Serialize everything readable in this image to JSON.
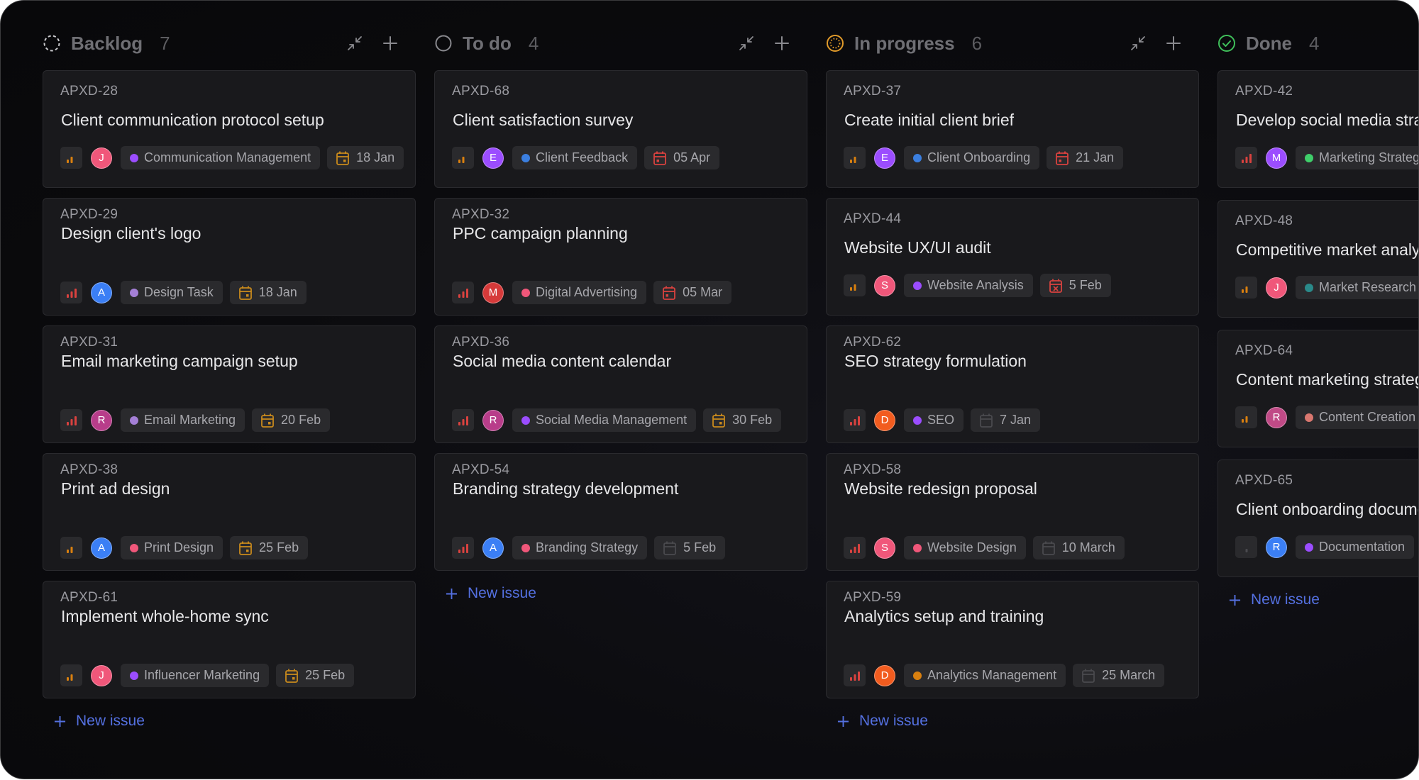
{
  "board": {
    "columns": [
      {
        "id": "backlog",
        "title": "Backlog",
        "count": "7",
        "status_icon": "backlog-dashed-circle-icon",
        "status_color": "#c8c8cc",
        "new_issue_label": "New issue",
        "cards": [
          {
            "id": "APXD-28",
            "title": "Client communication protocol setup",
            "priority": "low",
            "assignee": "J",
            "avatar_color": "#f0577a",
            "label": "Communication Management",
            "label_color": "#9b4dff",
            "date": "18 Jan",
            "date_state": "upcoming"
          },
          {
            "id": "APXD-29",
            "title": "Design client's logo",
            "priority": "high",
            "assignee": "A",
            "avatar_color": "#3b7ff5",
            "label": "Design Task",
            "label_color": "#a47fd6",
            "date": "18 Jan",
            "date_state": "upcoming"
          },
          {
            "id": "APXD-31",
            "title": "Email marketing campaign setup",
            "priority": "high",
            "assignee": "R",
            "avatar_color": "#b83d8a",
            "label": "Email Marketing",
            "label_color": "#a47fd6",
            "date": "20 Feb",
            "date_state": "upcoming"
          },
          {
            "id": "APXD-38",
            "title": "Print ad design",
            "priority": "low",
            "assignee": "A",
            "avatar_color": "#3b7ff5",
            "label": "Print Design",
            "label_color": "#f0577a",
            "date": "25 Feb",
            "date_state": "upcoming"
          },
          {
            "id": "APXD-61",
            "title": "Implement whole-home sync",
            "priority": "low",
            "assignee": "J",
            "avatar_color": "#f0577a",
            "label": "Influencer Marketing",
            "label_color": "#9b4dff",
            "date": "25 Feb",
            "date_state": "upcoming"
          }
        ]
      },
      {
        "id": "todo",
        "title": "To do",
        "count": "4",
        "status_icon": "todo-circle-icon",
        "status_color": "#8a8a8f",
        "new_issue_label": "New issue",
        "cards": [
          {
            "id": "APXD-68",
            "title": "Client satisfaction survey",
            "priority": "low",
            "assignee": "E",
            "avatar_color": "#9b4dff",
            "label": "Client Feedback",
            "label_color": "#3b7fe0",
            "date": "05 Apr",
            "date_state": "due"
          },
          {
            "id": "APXD-32",
            "title": "PPC campaign planning",
            "priority": "high",
            "assignee": "M",
            "avatar_color": "#d63a3a",
            "label": "Digital Advertising",
            "label_color": "#f0577a",
            "date": "05 Mar",
            "date_state": "due"
          },
          {
            "id": "APXD-36",
            "title": "Social media content calendar",
            "priority": "high",
            "assignee": "R",
            "avatar_color": "#b83d8a",
            "label": "Social Media Management",
            "label_color": "#9b4dff",
            "date": "30 Feb",
            "date_state": "upcoming"
          },
          {
            "id": "APXD-54",
            "title": "Branding strategy development",
            "priority": "high",
            "assignee": "A",
            "avatar_color": "#3b7ff5",
            "label": "Branding Strategy",
            "label_color": "#f0577a",
            "date": "5 Feb",
            "date_state": "none"
          }
        ]
      },
      {
        "id": "in-progress",
        "title": "In progress",
        "count": "6",
        "status_icon": "in-progress-circle-icon",
        "status_color": "#e09a2a",
        "new_issue_label": "New issue",
        "cards": [
          {
            "id": "APXD-37",
            "title": "Create initial client brief",
            "priority": "low",
            "assignee": "E",
            "avatar_color": "#9b4dff",
            "label": "Client Onboarding",
            "label_color": "#3b7fe0",
            "date": "21 Jan",
            "date_state": "due"
          },
          {
            "id": "APXD-44",
            "title": "Website UX/UI audit",
            "priority": "low",
            "assignee": "S",
            "avatar_color": "#f0577a",
            "label": "Website Analysis",
            "label_color": "#9b4dff",
            "date": "5 Feb",
            "date_state": "overdue"
          },
          {
            "id": "APXD-62",
            "title": "SEO strategy formulation",
            "priority": "high",
            "assignee": "D",
            "avatar_color": "#f25c1f",
            "label": "SEO",
            "label_color": "#9b4dff",
            "date": "7 Jan",
            "date_state": "none"
          },
          {
            "id": "APXD-58",
            "title": "Website redesign proposal",
            "priority": "high",
            "assignee": "S",
            "avatar_color": "#f0577a",
            "label": "Website Design",
            "label_color": "#f0577a",
            "date": "10 March",
            "date_state": "none"
          },
          {
            "id": "APXD-59",
            "title": "Analytics setup and training",
            "priority": "high",
            "assignee": "D",
            "avatar_color": "#f25c1f",
            "label": "Analytics Management",
            "label_color": "#d9800f",
            "date": "25 March",
            "date_state": "none"
          }
        ]
      },
      {
        "id": "done",
        "title": "Done",
        "count": "4",
        "status_icon": "done-check-circle-icon",
        "status_color": "#3fbf5a",
        "new_issue_label": "New issue",
        "cards": [
          {
            "id": "APXD-42",
            "title": "Develop social media strategy",
            "priority": "high",
            "assignee": "M",
            "avatar_color": "#9b4dff",
            "label": "Marketing Strategy",
            "label_color": "#3fcf6a",
            "date": "",
            "date_state": "none"
          },
          {
            "id": "APXD-48",
            "title": "Competitive market analysis",
            "priority": "low",
            "assignee": "J",
            "avatar_color": "#f0577a",
            "label": "Market Research",
            "label_color": "#2a8a8a",
            "date": "",
            "date_state": "none"
          },
          {
            "id": "APXD-64",
            "title": "Content marketing strategy",
            "priority": "low",
            "assignee": "R",
            "avatar_color": "#c04a86",
            "label": "Content Creation",
            "label_color": "#d9776f",
            "date": "",
            "date_state": "none"
          },
          {
            "id": "APXD-65",
            "title": "Client onboarding documentation",
            "priority": "none",
            "assignee": "R",
            "avatar_color": "#3b7ff5",
            "label": "Documentation",
            "label_color": "#9b4dff",
            "date": "",
            "date_state": "none"
          }
        ]
      }
    ]
  },
  "colors": {
    "priority_high": "#d9423f",
    "priority_low": "#d9800f",
    "priority_none": "#4a4a4e",
    "date_upcoming": "#c98a1c",
    "date_due": "#d9423f",
    "date_overdue": "#d9423f",
    "date_none": "#4a4a4e",
    "accent_link": "#5470e0"
  }
}
